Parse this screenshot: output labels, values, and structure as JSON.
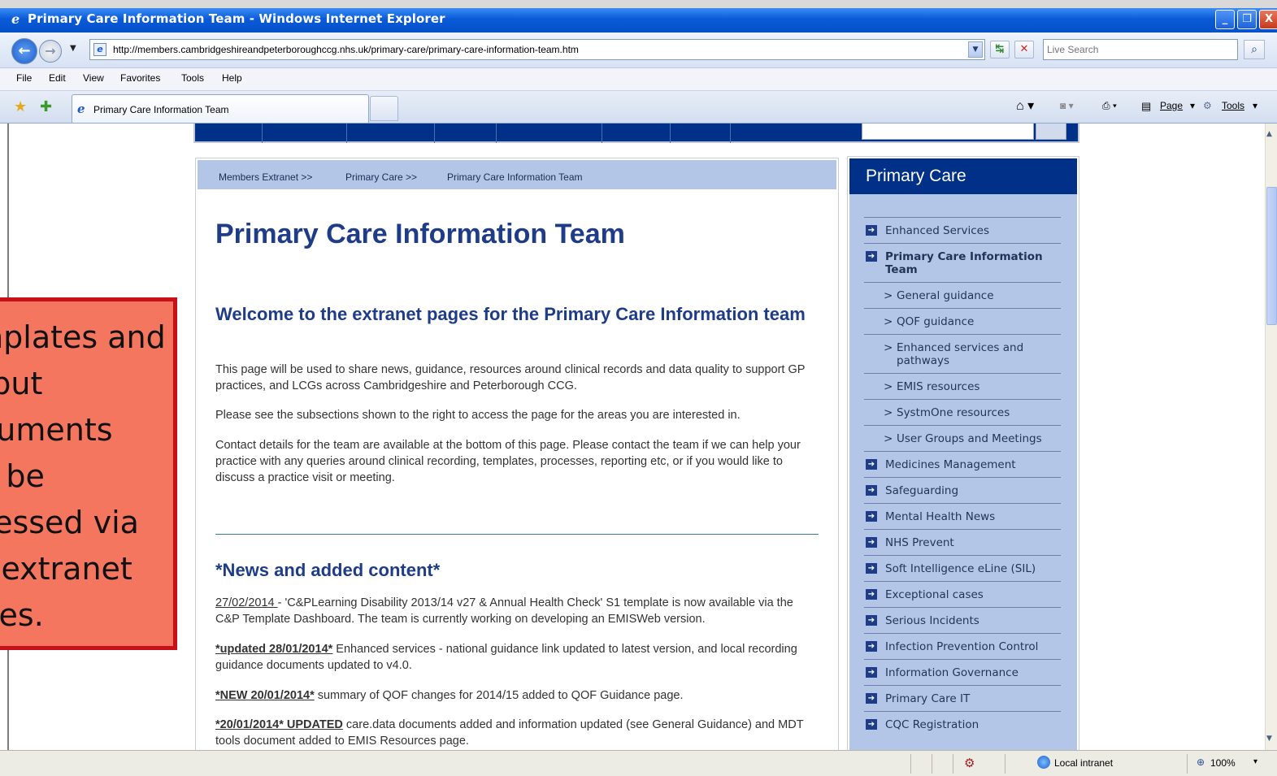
{
  "window": {
    "title": "Primary Care Information Team - Windows Internet Explorer",
    "minimize": "_",
    "maximize": "❐",
    "close": "X"
  },
  "address_bar": {
    "url": "http://members.cambridgeshireandpeterboroughccg.nhs.uk/primary-care/primary-care-information-team.htm",
    "search_placeholder": "Live Search"
  },
  "menu": [
    "File",
    "Edit",
    "View",
    "Favorites",
    "Tools",
    "Help"
  ],
  "tab": {
    "label": "Primary Care Information Team"
  },
  "command_bar": {
    "page": "Page",
    "tools": "Tools"
  },
  "breadcrumb": [
    "Members Extranet >>",
    "Primary Care >>",
    "Primary Care Information Team"
  ],
  "main": {
    "title": "Primary Care Information Team",
    "welcome_heading": "Welcome to the extranet pages for the Primary Care Information team",
    "paragraphs": [
      "This page will be used to share news, guidance, resources around clinical records and data quality to support GP practices, and LCGs across Cambridgeshire and Peterborough CCG.",
      "Please see the subsections shown to the right to access the page for the areas you are interested in.",
      "Contact details for the team are available at the bottom of this page.  Please contact the team if we can help your practice with any queries around clinical recording, templates, processes, reporting etc, or if you would like to discuss a practice visit or meeting."
    ],
    "news_heading": "*News and added content*",
    "news": [
      {
        "link": "27/02/2014 ",
        "text": "- 'C&PLearning Disability 2013/14 v27 & Annual Health Check' S1 template is now available via the C&P Template Dashboard. The team is currently working on developing an EMISWeb version."
      },
      {
        "link": "*updated 28/01/2014*",
        "text": " Enhanced services - national guidance link updated to latest version, and local recording guidance documents updated to v4.0."
      },
      {
        "link": "*NEW 20/01/2014*",
        "text": " summary of QOF changes for 2014/15 added to QOF Guidance page."
      },
      {
        "link": "*20/01/2014* UPDATED",
        "text": " care.data documents added and information updated (see General Guidance) and MDT tools document added to EMIS Resources page."
      }
    ]
  },
  "sidebar": {
    "heading": "Primary Care",
    "items": [
      {
        "label": "Enhanced Services",
        "type": "main"
      },
      {
        "label": "Primary Care Information Team",
        "type": "active"
      },
      {
        "label": "General guidance",
        "type": "sub"
      },
      {
        "label": "QOF guidance",
        "type": "sub"
      },
      {
        "label": "Enhanced services and pathways",
        "type": "sub"
      },
      {
        "label": "EMIS resources",
        "type": "sub"
      },
      {
        "label": "SystmOne resources",
        "type": "sub"
      },
      {
        "label": "User Groups and Meetings",
        "type": "sub"
      },
      {
        "label": "Medicines Management",
        "type": "main"
      },
      {
        "label": "Safeguarding",
        "type": "main"
      },
      {
        "label": "Mental Health News",
        "type": "main"
      },
      {
        "label": "NHS Prevent",
        "type": "main"
      },
      {
        "label": "Soft Intelligence eLine (SIL)",
        "type": "main"
      },
      {
        "label": "Exceptional cases",
        "type": "main"
      },
      {
        "label": "Serious Incidents",
        "type": "main"
      },
      {
        "label": "Infection Prevention Control",
        "type": "main"
      },
      {
        "label": "Information Governance",
        "type": "main"
      },
      {
        "label": "Primary Care IT",
        "type": "main"
      },
      {
        "label": "CQC Registration",
        "type": "main"
      }
    ]
  },
  "callout": {
    "text": "Templates and\noutput\ndocuments\ncan be\naccessed via\nthe extranet\npages."
  },
  "status_bar": {
    "zone": "Local intranet",
    "zoom": "100%"
  },
  "colors": {
    "nhs_blue": "#003087",
    "heading_blue": "#1f3c88",
    "sidebar_bg": "#b4c6e7",
    "callout_fill": "#f4765e",
    "callout_border": "#c9101a"
  }
}
